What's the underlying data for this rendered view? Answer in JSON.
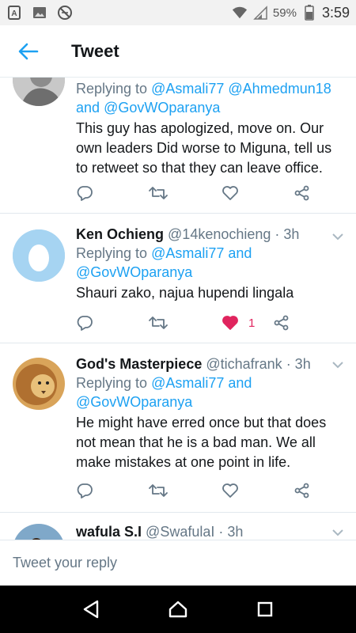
{
  "status_bar": {
    "battery": "59%",
    "time": "3:59"
  },
  "header": {
    "title": "Tweet"
  },
  "tweets": [
    {
      "name": "",
      "handle": "",
      "time": "",
      "replying_prefix": "Replying to",
      "replying_users": [
        "@Asmali77",
        "@Ahmedmun18"
      ],
      "replying_and": "and",
      "replying_last": "@GovWOparanya",
      "body": "This guy has apologized, move on. Our own leaders Did worse to Miguna,  tell us to retweet so that they can leave office.",
      "like_count": "",
      "avatar": "grayscale-person-photo"
    },
    {
      "name": "Ken Ochieng",
      "handle": "@14kenochieng",
      "time": "· 3h",
      "replying_prefix": "Replying to",
      "replying_users": [
        "@Asmali77"
      ],
      "replying_and": "and",
      "replying_last": "@GovWOparanya",
      "body": "Shauri zako, najua hupendi lingala",
      "like_count": "1",
      "avatar": "default-egg-avatar"
    },
    {
      "name": "God's Masterpiece",
      "handle": "@tichafrank",
      "time": "· 3h",
      "replying_prefix": "Replying to",
      "replying_users": [
        "@Asmali77"
      ],
      "replying_and": "and",
      "replying_last": "@GovWOparanya",
      "body": "He might have erred once but that does not mean that he is a bad man.  We all make mistakes  at one point in life.",
      "like_count": "",
      "avatar": "lion-photo"
    },
    {
      "name": "wafula S.I",
      "handle": "@SwafulaI",
      "time": "· 3h",
      "avatar": "outdoor-photo"
    }
  ],
  "reply_bar": {
    "placeholder": "Tweet your reply"
  },
  "colors": {
    "accent": "#1da1f2",
    "like_active": "#e0245e",
    "secondary_text": "#657786",
    "icon_gray": "#657786"
  }
}
